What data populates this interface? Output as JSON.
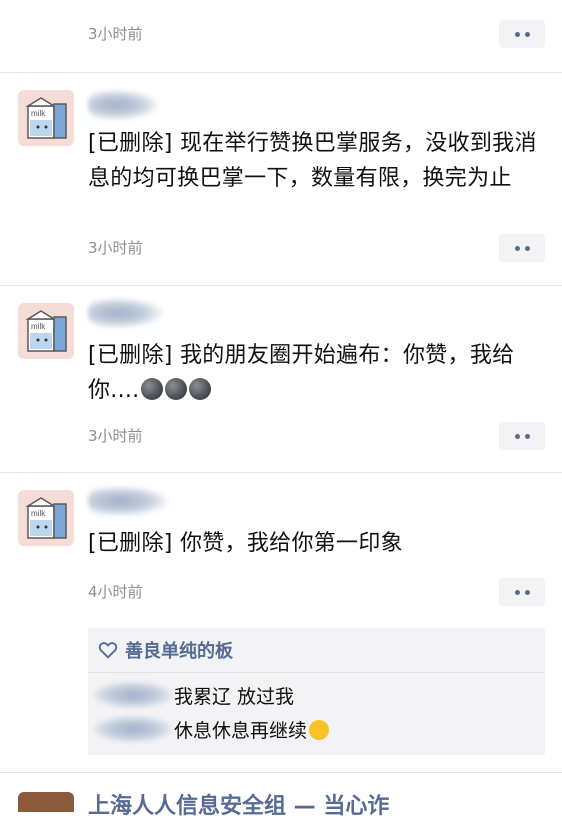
{
  "feed": {
    "top": {
      "time": "3小时前"
    },
    "posts": [
      {
        "text": "[已删除] 现在举行赞换巴掌服务，没收到我消息的均可换巴掌一下，数量有限，换完为止",
        "time": "3小时前"
      },
      {
        "text": "[已删除] 我的朋友圈开始遍布：你赞，我给你....",
        "time": "3小时前",
        "emojis": [
          "new-moon-face-emoji",
          "new-moon-face-emoji",
          "new-moon-face-emoji"
        ]
      },
      {
        "text": "[已删除] 你赞，我给你第一印象",
        "time": "4小时前"
      }
    ],
    "likes": {
      "icon": "heart-outline-icon",
      "names": "善良单纯的板"
    },
    "comments": [
      {
        "text": "我累辽 放过我"
      },
      {
        "text": "休息休息再继续",
        "emoji": "upside-down-face-emoji"
      }
    ],
    "bottom_partial": {
      "text": "上海人人信息安全组 — 当心诈"
    }
  },
  "colors": {
    "link": "#566b94",
    "time": "#8e8e8e",
    "more_button_bg": "#f3f3f5",
    "avatar_bg": "#f6dcd6"
  }
}
